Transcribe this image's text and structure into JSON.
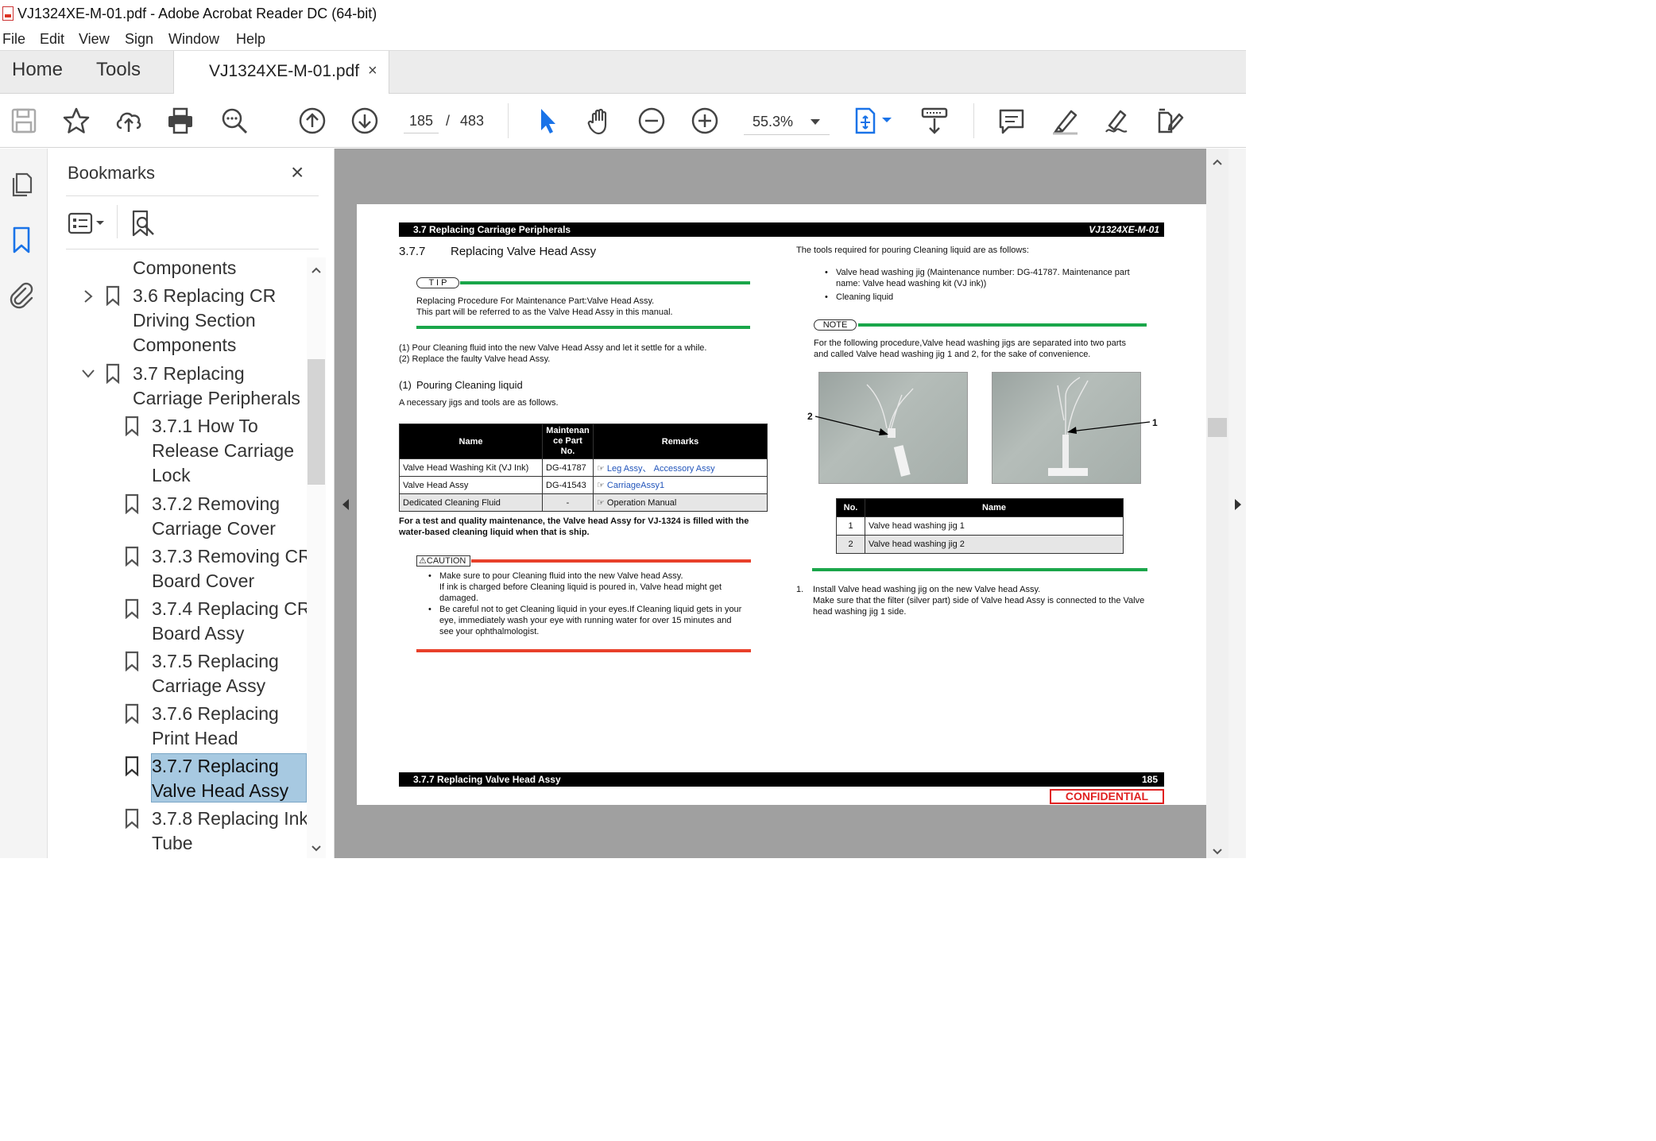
{
  "window": {
    "title": "VJ1324XE-M-01.pdf - Adobe Acrobat Reader DC (64-bit)"
  },
  "menu": [
    "File",
    "Edit",
    "View",
    "Sign",
    "Window",
    "Help"
  ],
  "tabs": {
    "home": "Home",
    "tools": "Tools",
    "document": "VJ1324XE-M-01.pdf",
    "close": "×"
  },
  "toolbar": {
    "page_current": "185",
    "page_sep": "/",
    "page_total": "483",
    "zoom": "55.3%"
  },
  "bookmarks": {
    "title": "Bookmarks",
    "close": "×",
    "items": [
      {
        "text": [
          "Components"
        ],
        "level": 1,
        "expander": "",
        "flag": false
      },
      {
        "text": [
          "3.6 Replacing CR",
          "Driving Section",
          "Components"
        ],
        "level": 1,
        "expander": "collapsed",
        "flag": true
      },
      {
        "text": [
          "3.7 Replacing",
          "Carriage Peripherals"
        ],
        "level": 1,
        "expander": "expanded",
        "flag": true
      },
      {
        "text": [
          "3.7.1 How To",
          "Release Carriage",
          "Lock"
        ],
        "level": 2,
        "flag": true
      },
      {
        "text": [
          "3.7.2 Removing",
          "Carriage Cover"
        ],
        "level": 2,
        "flag": true
      },
      {
        "text": [
          "3.7.3 Removing CR",
          "Board Cover"
        ],
        "level": 2,
        "flag": true
      },
      {
        "text": [
          "3.7.4 Replacing CR",
          "Board Assy"
        ],
        "level": 2,
        "flag": true
      },
      {
        "text": [
          "3.7.5 Replacing",
          "Carriage Assy"
        ],
        "level": 2,
        "flag": true
      },
      {
        "text": [
          "3.7.6 Replacing",
          "Print Head"
        ],
        "level": 2,
        "flag": true
      },
      {
        "text": [
          "3.7.7 Replacing",
          "Valve Head Assy"
        ],
        "level": 2,
        "flag": true,
        "selected": true
      },
      {
        "text": [
          "3.7.8 Replacing Ink",
          "Tube"
        ],
        "level": 2,
        "flag": true
      }
    ]
  },
  "pdf": {
    "header_left": "3.7 Replacing Carriage Peripherals",
    "header_right": "VJ1324XE-M-01",
    "section_num": "3.7.7",
    "section_title": "Replacing Valve Head Assy",
    "tip_label": "T I P",
    "tip_line1": "Replacing Procedure For Maintenance Part:Valve Head Assy.",
    "tip_line2": "This part will be referred to as the Valve Head Assy in this manual.",
    "step_line1": "(1) Pour Cleaning fluid into the new  Valve Head Assy and let it settle for a while.",
    "step_line2": "(2) Replace the faulty Valve head Assy.",
    "sub_num": "(1)",
    "sub_title": "Pouring Cleaning liquid",
    "jigs_intro": "A necessary jigs and tools are as follows.",
    "parts_table": {
      "headers": [
        "Name",
        "Maintenan ce Part No.",
        "Remarks"
      ],
      "rows": [
        {
          "name": "Valve Head Washing Kit (VJ Ink)",
          "part": "DG-41787",
          "remarks": "Leg  Assy、 Accessory Assy"
        },
        {
          "name": "Valve Head Assy",
          "part": "DG-41543",
          "remarks": "CarriageAssy1"
        },
        {
          "name": "Dedicated Cleaning Fluid",
          "part": "-",
          "remarks": "Operation Manual"
        }
      ]
    },
    "bold_note_1": "For a test and quality maintenance, the Valve head Assy for VJ-1324 is filled with the",
    "bold_note_2": "water-based cleaning liquid when that is ship.",
    "caution_label": "CAUTION",
    "caution_1a": "Make sure to pour Cleaning fluid into the new Valve head Assy.",
    "caution_1b": "If ink is charged before Cleaning liquid is poured in, Valve head might get",
    "caution_1c": "damaged.",
    "caution_2a": "Be careful not to get Cleaning liquid in your eyes.If Cleaning liquid gets in your",
    "caution_2b": "eye, immediately wash your eye with running water for over 15 minutes and",
    "caution_2c": "see your ophthalmologist.",
    "tools_intro": "The tools required for pouring Cleaning liquid are as follows:",
    "tool_1a": "Valve head washing jig (Maintenance number: DG-41787. Maintenance part",
    "tool_1b": "name: Valve head washing kit (VJ ink))",
    "tool_2": "Cleaning liquid",
    "note_label": "NOTE",
    "note_line1": "For the following procedure,Valve head washing jigs are separated into two parts",
    "note_line2": "and called Valve head washing jig 1 and 2, for the sake of convenience.",
    "photo_label_2": "2",
    "photo_label_1": "1",
    "jig_table": {
      "headers": [
        "No.",
        "Name"
      ],
      "rows": [
        {
          "no": "1",
          "name": "Valve head washing jig 1"
        },
        {
          "no": "2",
          "name": "Valve head washing jig 2"
        }
      ]
    },
    "install_num": "1.",
    "install_1": "Install Valve head washing jig on the new Valve head Assy.",
    "install_2": "Make sure that the filter (silver part) side of Valve head Assy is connected to the Valve",
    "install_3": "head washing jig 1 side.",
    "footer_left": "3.7.7 Replacing Valve Head Assy",
    "footer_right": "185",
    "confidential": "CONFIDENTIAL"
  },
  "colors": {
    "accent_blue": "#1a73e8",
    "selection": "#a7c9e1",
    "green_rule": "#1aa64a",
    "red_rule": "#e8402a"
  }
}
